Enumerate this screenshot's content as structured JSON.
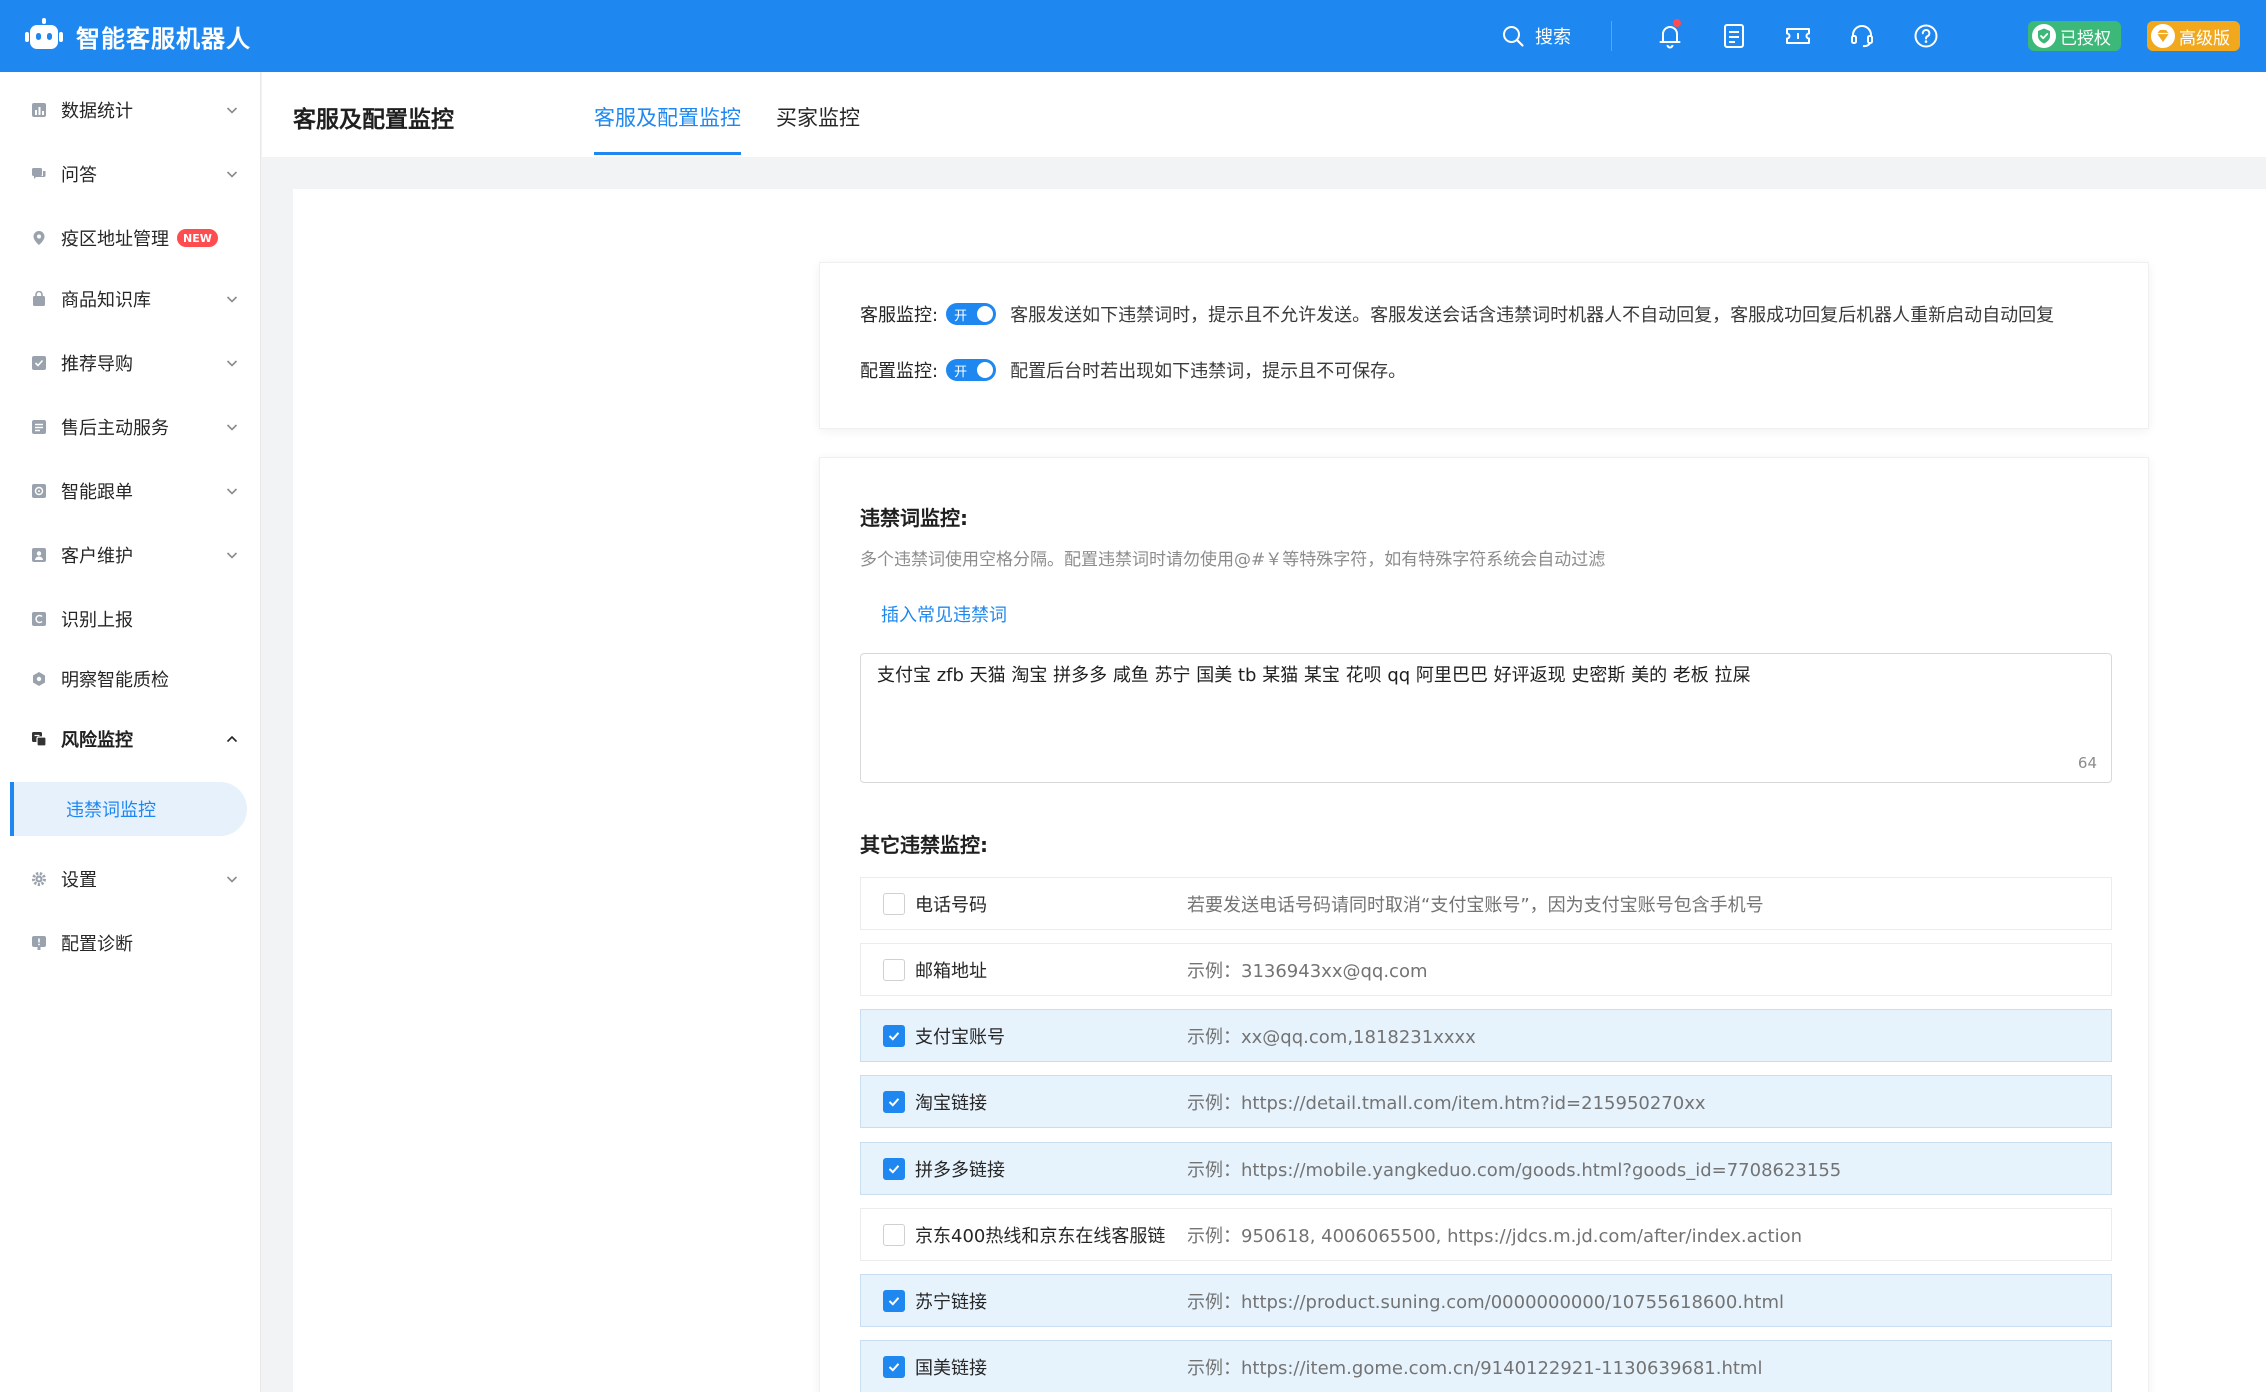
{
  "app": {
    "title": "智能客服机器人"
  },
  "topbar": {
    "search_label": "搜索",
    "badge_authorized": "已授权",
    "badge_edition": "高级版"
  },
  "sidebar": {
    "items": [
      {
        "label": "数据统计",
        "icon": "bar-chart-icon",
        "caret": "down"
      },
      {
        "label": "问答",
        "icon": "chat-icon",
        "caret": "down"
      },
      {
        "label": "疫区地址管理",
        "icon": "location-pin-icon",
        "tag": "NEW"
      },
      {
        "label": "商品知识库",
        "icon": "bag-icon",
        "caret": "down"
      },
      {
        "label": "推荐导购",
        "icon": "recommend-icon",
        "caret": "down"
      },
      {
        "label": "售后主动服务",
        "icon": "service-icon",
        "caret": "down"
      },
      {
        "label": "智能跟单",
        "icon": "tracking-icon",
        "caret": "down"
      },
      {
        "label": "客户维护",
        "icon": "customer-icon",
        "caret": "down"
      },
      {
        "label": "识别上报",
        "icon": "report-icon"
      },
      {
        "label": "明察智能质检",
        "icon": "inspect-icon"
      },
      {
        "label": "风险监控",
        "icon": "risk-icon",
        "caret": "up",
        "expanded": true
      },
      {
        "label": "设置",
        "icon": "gear-icon",
        "caret": "down"
      },
      {
        "label": "配置诊断",
        "icon": "diagnose-icon"
      }
    ],
    "sub_active": "违禁词监控"
  },
  "header": {
    "page_title": "客服及配置监控",
    "tabs": [
      "客服及配置监控",
      "买家监控"
    ],
    "active_tab": 0
  },
  "monitor": {
    "service": {
      "label": "客服监控:",
      "switch_text": "开",
      "desc": "客服发送如下违禁词时，提示且不允许发送。客服发送会话含违禁词时机器人不自动回复，客服成功回复后机器人重新启动自动回复"
    },
    "config": {
      "label": "配置监控:",
      "switch_text": "开",
      "desc": "配置后台时若出现如下违禁词，提示且不可保存。"
    }
  },
  "forbidden": {
    "title": "违禁词监控:",
    "hint": "多个违禁词使用空格分隔。配置违禁词时请勿使用@#￥等特殊字符，如有特殊字符系统会自动过滤",
    "insert_link": "插入常见违禁词",
    "words": "支付宝 zfb 天猫 淘宝 拼多多 咸鱼 苏宁 国美 tb 某猫 某宝 花呗 qq 阿里巴巴 好评返现 史密斯 美的 老板 拉屎",
    "count": "64"
  },
  "others": {
    "title": "其它违禁监控:",
    "options": [
      {
        "name": "电话号码",
        "desc": "若要发送电话号码请同时取消“支付宝账号”，因为支付宝账号包含手机号",
        "checked": false
      },
      {
        "name": "邮箱地址",
        "desc": "示例：3136943xx@qq.com",
        "checked": false
      },
      {
        "name": "支付宝账号",
        "desc": "示例：xx@qq.com,1818231xxxx",
        "checked": true
      },
      {
        "name": "淘宝链接",
        "desc": "示例：https://detail.tmall.com/item.htm?id=215950270xx",
        "checked": true
      },
      {
        "name": "拼多多链接",
        "desc": "示例：https://mobile.yangkeduo.com/goods.html?goods_id=7708623155",
        "checked": true
      },
      {
        "name": "京东400热线和京东在线客服链",
        "desc": "示例：950618, 4006065500, https://jdcs.m.jd.com/after/index.action",
        "checked": false
      },
      {
        "name": "苏宁链接",
        "desc": "示例：https://product.suning.com/0000000000/10755618600.html",
        "checked": true
      },
      {
        "name": "国美链接",
        "desc": "示例：https://item.gome.com.cn/9140122921-1130639681.html",
        "checked": true
      }
    ]
  },
  "colors": {
    "brand": "#1e88f0",
    "authorized": "#3cb878",
    "edition": "#f2a81c",
    "new_tag": "#ff4d4f",
    "checked_row": "#e6f3fd"
  }
}
